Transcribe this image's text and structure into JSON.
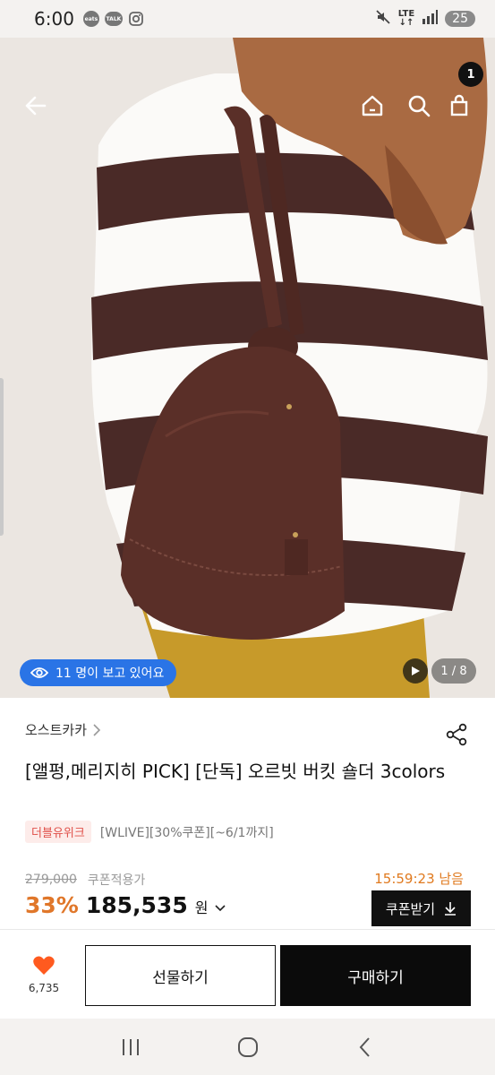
{
  "status_bar": {
    "time": "6:00",
    "icons": [
      "baemin-eats-icon",
      "kakaotalk-icon",
      "instagram-icon"
    ],
    "right_icons": [
      "mute-icon",
      "lte-icon",
      "signal-icon"
    ],
    "lte_label": "LTE",
    "battery": "25"
  },
  "hero": {
    "viewers_text": "11 명이 보고 있어요",
    "page_indicator": "1 / 8",
    "cart_count": "1"
  },
  "product": {
    "brand": "오스트카카",
    "title": "[앨펑,메리지히 PICK] [단독] 오르빗 버킷 숄더 3colors",
    "promo_badge": "더블유위크",
    "promo_text": "[WLIVE][30%쿠폰][~6/1까지]",
    "original_price": "279,000",
    "coupon_label": "쿠폰적용가",
    "timer": "15:59:23 남음",
    "discount": "33%",
    "price": "185,535",
    "currency": "원",
    "coupon_button": "쿠폰받기"
  },
  "bottom_bar": {
    "like_count": "6,735",
    "gift_button": "선물하기",
    "buy_button": "구매하기"
  },
  "colors": {
    "accent_orange": "#e0772a",
    "timer_orange": "#e07a1f",
    "viewer_blue": "#2a74e6",
    "heart_orange": "#ff5a1f",
    "promo_red": "#e0504a",
    "bag_brown": "#5a2f28"
  }
}
